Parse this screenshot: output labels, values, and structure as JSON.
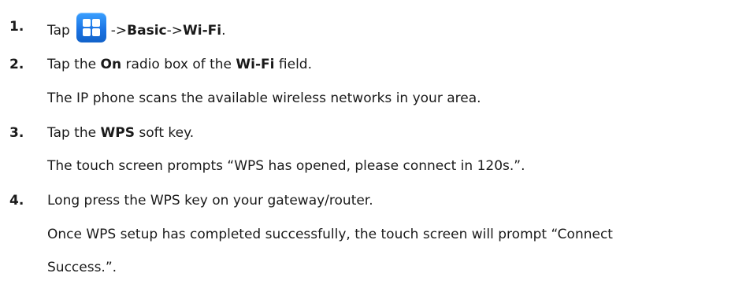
{
  "steps": [
    {
      "number": "1.",
      "text_before_icon": "Tap",
      "icon": "menu-grid-icon",
      "arrow1": "->",
      "menu1": "Basic",
      "arrow2": "->",
      "menu2": "Wi-Fi",
      "end": "."
    },
    {
      "number": "2.",
      "t1": "Tap the ",
      "b1": "On",
      "t2": " radio box of the ",
      "b2": "Wi-Fi",
      "t3": " field.",
      "note": "The IP phone scans the available wireless networks in your area."
    },
    {
      "number": "3.",
      "t1": "Tap the ",
      "b1": "WPS",
      "t2": " soft key.",
      "note": "The touch screen prompts “WPS has opened, please connect in 120s.”."
    },
    {
      "number": "4.",
      "text": "Long press the WPS key on your gateway/router.",
      "note_line1": "Once WPS setup has completed successfully, the touch screen will prompt “Connect",
      "note_line2": "Success.”."
    }
  ],
  "colors": {
    "icon_blue": "#1b74e4",
    "text": "#1a1a1a"
  }
}
